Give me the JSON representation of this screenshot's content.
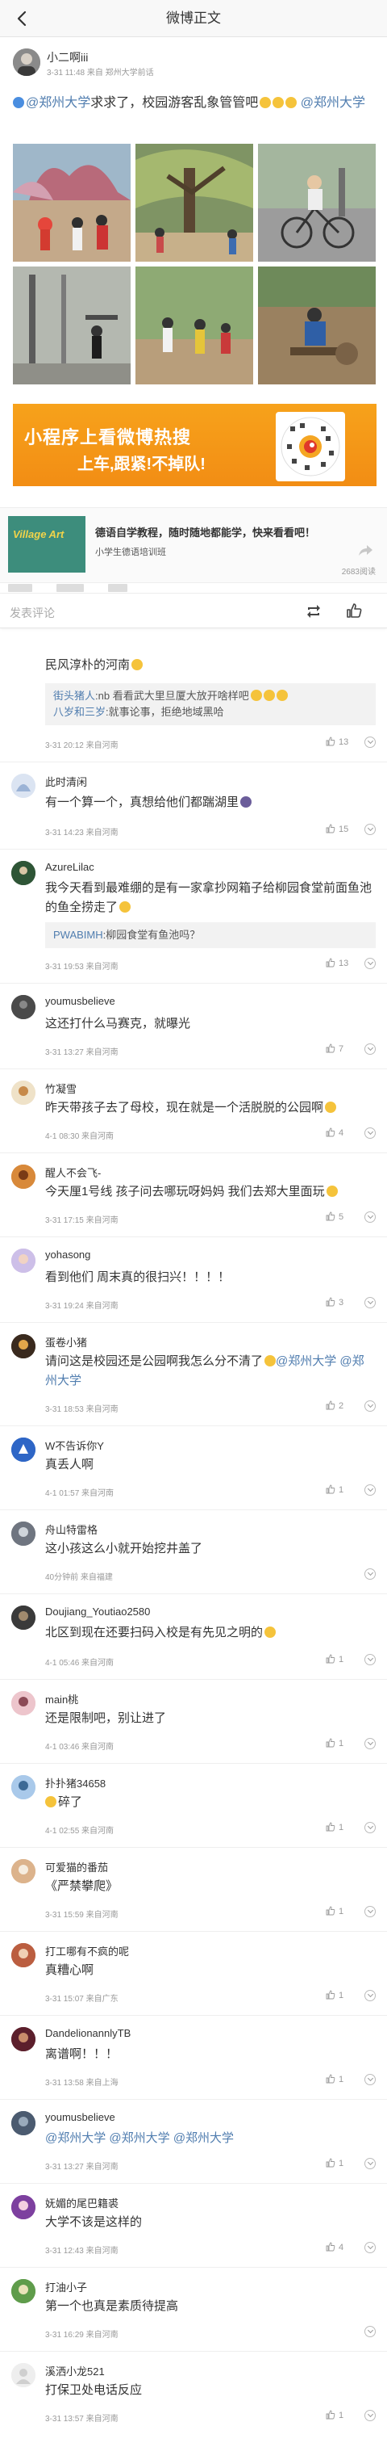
{
  "header": {
    "title": "微博正文",
    "back_icon": "back-arrow-icon"
  },
  "post": {
    "author": "小二啊iii",
    "meta": "3-31 11:48 来自 郑州大学前话",
    "text_link1": "@郑州大学",
    "text_body": "求求了，校园游客乱象管管吧",
    "text_link2": "@郑州大学",
    "photo_count": 6
  },
  "banner": {
    "line1": "小程序上看微博热搜",
    "line2": "上车,跟紧!不掉队!",
    "qr_icon": "miniprogram-qr-icon",
    "color": "#f5991a"
  },
  "card": {
    "image_text": "Village Art",
    "title": "德语自学教程，随时随地都能学，快来看看吧！",
    "subtitle": "小学生德语培训班",
    "count": "2683阅读",
    "share_icon": "share-icon"
  },
  "comment_bar": {
    "placeholder": "发表评论",
    "repost_icon": "repost-icon",
    "like_icon": "like-icon"
  },
  "comments": [
    {
      "name": "",
      "text": "民风淳朴的河南",
      "reply_user1": "街头猪人",
      "reply_body1": ":nb 看看武大里旦厦大放开啥样吧",
      "reply_user2": "八岁和三岁",
      "reply_body2": ":就事论事，拒绝地域黑哈",
      "time": "3-31 20:12 来自河南",
      "likes": "13"
    },
    {
      "name": "此时清闲",
      "text": "有一个算一个，真想给他们都踹湖里",
      "time": "3-31 14:23 来自河南",
      "likes": "15"
    },
    {
      "name": "AzureLilac",
      "text": "我今天看到最难绷的是有一家拿抄网箱子给柳园食堂前面鱼池的鱼全捞走了",
      "reply_user1": "PWABIMH",
      "reply_body1": ":柳园食堂有鱼池吗？",
      "time": "3-31 19:53 来自河南",
      "likes": "13"
    },
    {
      "name": "youmusbelieve",
      "text": "这还打什么马赛克，就曝光",
      "time": "3-31 13:27 来自河南",
      "likes": "7"
    },
    {
      "name": "竹凝雪",
      "text": "昨天带孩子去了母校，现在就是一个活脱脱的公园啊",
      "time": "4-1 08:30 来自河南",
      "likes": "4"
    },
    {
      "name": "醒人不会飞-",
      "text": "今天厘1号线 孩子问去哪玩呀妈妈 我们去郑大里面玩",
      "time": "3-31 17:15 来自河南",
      "likes": "5"
    },
    {
      "name": "yohasong",
      "text": "看到他们 周末真的很扫兴！！！！",
      "time": "3-31 19:24 来自河南",
      "likes": "3"
    },
    {
      "name": "蛋卷小猪",
      "text": "请问这是校园还是公园啊我怎么分不清了",
      "link1": "@郑州大学",
      "link2": "@郑州大学",
      "time": "3-31 18:53 来自河南",
      "likes": "2"
    },
    {
      "name": "W不告诉你Y",
      "text": "真丢人啊",
      "time": "4-1 01:57 来自河南",
      "likes": "1"
    },
    {
      "name": "舟山特雷格",
      "text": "这小孩这么小就开始挖井盖了",
      "time": "40分钟前 来自福建",
      "likes": ""
    },
    {
      "name": "Doujiang_Youtiao2580",
      "text": "北区到现在还要扫码入校是有先见之明的",
      "time": "4-1 05:46 来自河南",
      "likes": "1"
    },
    {
      "name": "main桃",
      "text": "还是限制吧，别让进了",
      "time": "4-1 03:46 来自河南",
      "likes": "1"
    },
    {
      "name": "扑扑猪34658",
      "text": "碎了",
      "time": "4-1 02:55 来自河南",
      "likes": "1"
    },
    {
      "name": "可爱猫的番茄",
      "text": "《严禁攀爬》",
      "time": "3-31 15:59 来自河南",
      "likes": "1"
    },
    {
      "name": "打工哪有不疯的呢",
      "text": "真糟心啊",
      "time": "3-31 15:07 来自广东",
      "likes": "1"
    },
    {
      "name": "DandelionannlyTB",
      "text": "离谱啊！！！",
      "time": "3-31 13:58 来自上海",
      "likes": "1"
    },
    {
      "name": "youmusbelieve",
      "text": "",
      "link1": "@郑州大学",
      "link2": "@郑州大学",
      "link3": "@郑州大学",
      "time": "3-31 13:27 来自河南",
      "likes": "1"
    },
    {
      "name": "妩媚的尾巴籍裘",
      "text": "大学不该是这样的",
      "time": "3-31 12:43 来自河南",
      "likes": "4"
    },
    {
      "name": "打油小子",
      "text": "第一个也真是素质待提高",
      "time": "3-31 16:29 来自河南",
      "likes": ""
    },
    {
      "name": "溪洒小龙521",
      "text": "打保卫处电话反应",
      "time": "3-31 13:57 来自河南",
      "likes": "1"
    }
  ]
}
